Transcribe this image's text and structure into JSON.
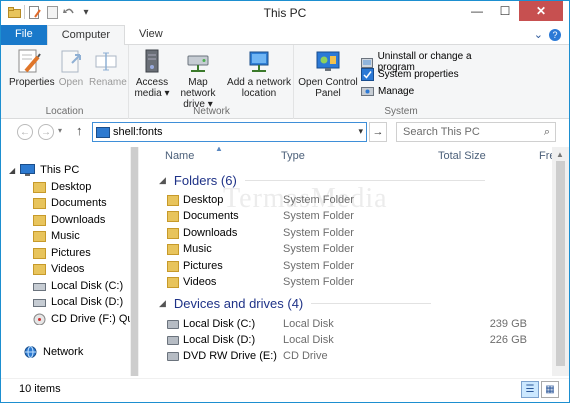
{
  "window": {
    "title": "This PC"
  },
  "qat": {
    "dropdown": "▾"
  },
  "window_controls": {
    "minimize": "—",
    "maximize": "☐",
    "close": "✕"
  },
  "tabs": [
    {
      "label": "File"
    },
    {
      "label": "Computer"
    },
    {
      "label": "View"
    }
  ],
  "help": {
    "chevron": "⌄",
    "icon": "?"
  },
  "ribbon": {
    "location": {
      "label": "Location",
      "properties": "Properties",
      "open": "Open",
      "rename": "Rename"
    },
    "network": {
      "label": "Network",
      "access_media": [
        "Access",
        "media ▾"
      ],
      "map_network_drive": [
        "Map network",
        "drive ▾"
      ],
      "add_network_location": [
        "Add a network",
        "location"
      ]
    },
    "system": {
      "label": "System",
      "open_control_panel": [
        "Open Control",
        "Panel"
      ],
      "uninstall": "Uninstall or change a program",
      "system_properties": "System properties",
      "manage": "Manage"
    }
  },
  "address": {
    "back": "←",
    "forward": "→",
    "history": "▾",
    "up": "↑",
    "path": "shell:fonts",
    "dropdown": "▾",
    "go": "→",
    "search_placeholder": "Search This PC",
    "search_icon": "⌕"
  },
  "nav_pane": {
    "this_pc": "This PC",
    "items": [
      "Desktop",
      "Documents",
      "Downloads",
      "Music",
      "Pictures",
      "Videos",
      "Local Disk (C:)",
      "Local Disk (D:)",
      "CD Drive (F:) Quick N"
    ],
    "network": "Network"
  },
  "columns": {
    "name": "Name",
    "type": "Type",
    "total_size": "Total Size",
    "free": "Fre"
  },
  "folders_group": {
    "title": "Folders (6)",
    "items": [
      {
        "name": "Desktop",
        "type": "System Folder"
      },
      {
        "name": "Documents",
        "type": "System Folder"
      },
      {
        "name": "Downloads",
        "type": "System Folder"
      },
      {
        "name": "Music",
        "type": "System Folder"
      },
      {
        "name": "Pictures",
        "type": "System Folder"
      },
      {
        "name": "Videos",
        "type": "System Folder"
      }
    ]
  },
  "drives_group": {
    "title": "Devices and drives (4)",
    "items": [
      {
        "name": "Local Disk (C:)",
        "type": "Local Disk",
        "size": "239 GB"
      },
      {
        "name": "Local Disk (D:)",
        "type": "Local Disk",
        "size": "226 GB"
      },
      {
        "name": "DVD RW Drive (E:)",
        "type": "CD Drive",
        "size": ""
      }
    ]
  },
  "watermark": "TermasMedia",
  "status": {
    "count": "10 items"
  },
  "colors": {
    "accent": "#1979ca",
    "group_header": "#1e3287",
    "folder": "#e8c45c"
  }
}
